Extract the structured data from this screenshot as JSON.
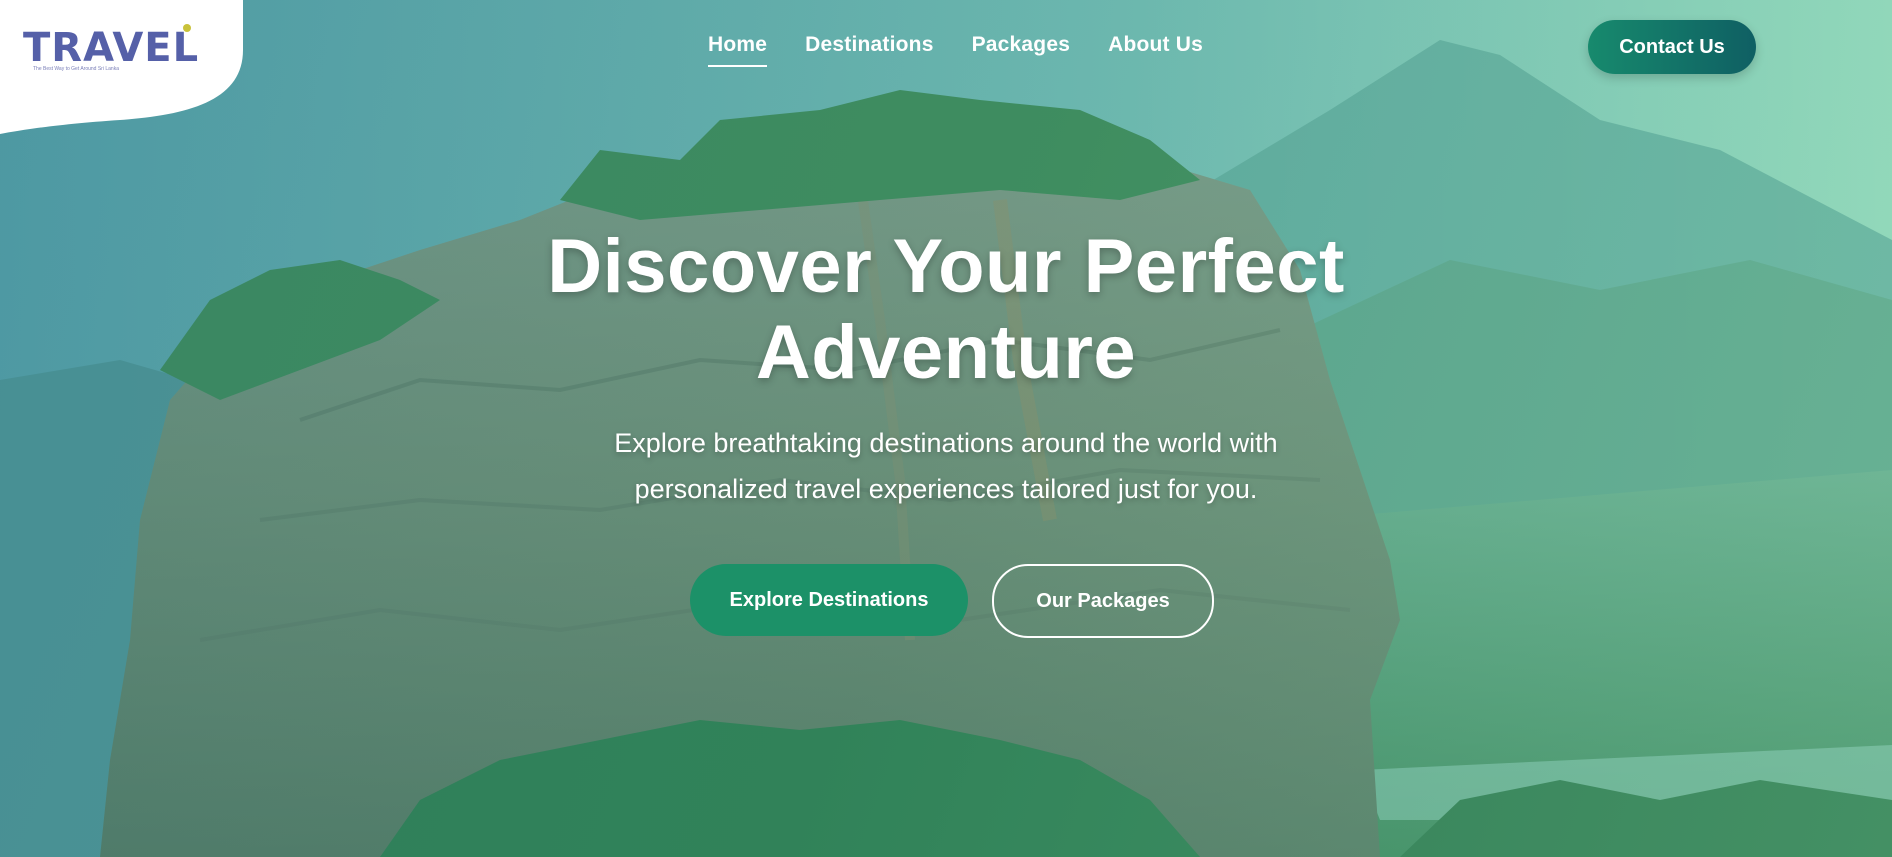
{
  "brand": {
    "logo_text": "TRAVEL",
    "tagline": "The Best Way to Get Around Sri Lanka"
  },
  "nav": {
    "items": [
      {
        "label": "Home",
        "active": true
      },
      {
        "label": "Destinations",
        "active": false
      },
      {
        "label": "Packages",
        "active": false
      },
      {
        "label": "About Us",
        "active": false
      }
    ],
    "contact_label": "Contact Us"
  },
  "hero": {
    "title": "Discover Your Perfect Adventure",
    "subtitle": "Explore breathtaking destinations around the world with personalized travel experiences tailored just for you.",
    "primary_button": "Explore Destinations",
    "secondary_button": "Our Packages"
  },
  "colors": {
    "brand_primary": "#5560a8",
    "accent_green": "#1c9168",
    "contact_gradient_start": "#178a6d",
    "contact_gradient_end": "#0f5f63",
    "logo_accent": "#c9c23a"
  }
}
